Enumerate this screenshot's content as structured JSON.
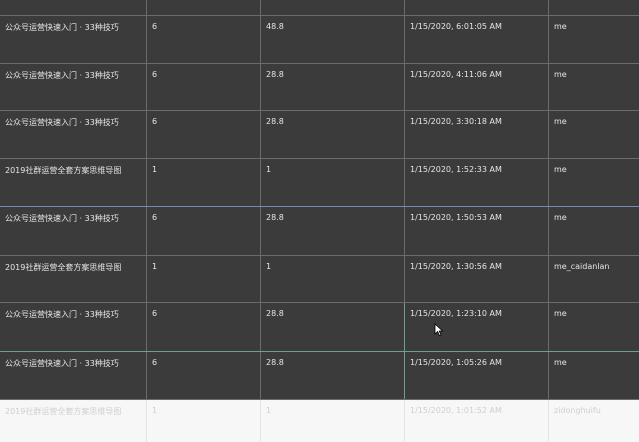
{
  "rows": [
    {
      "title": "公众号运营快速入门 · 33种技巧",
      "qty": "6",
      "amount": "48.8",
      "time": "1/15/2020, 6:01:05 AM",
      "user": "me"
    },
    {
      "title": "公众号运营快速入门 · 33种技巧",
      "qty": "6",
      "amount": "28.8",
      "time": "1/15/2020, 4:11:06 AM",
      "user": "me"
    },
    {
      "title": "公众号运营快速入门 · 33种技巧",
      "qty": "6",
      "amount": "28.8",
      "time": "1/15/2020, 3:30:18 AM",
      "user": "me"
    },
    {
      "title": "2019社群运营全套方案思维导图",
      "qty": "1",
      "amount": "1",
      "time": "1/15/2020, 1:52:33 AM",
      "user": "me"
    },
    {
      "title": "公众号运营快速入门 · 33种技巧",
      "qty": "6",
      "amount": "28.8",
      "time": "1/15/2020, 1:50:53 AM",
      "user": "me"
    },
    {
      "title": "2019社群运营全套方案思维导图",
      "qty": "1",
      "amount": "1",
      "time": "1/15/2020, 1:30:56 AM",
      "user": "me_caidanlan"
    },
    {
      "title": "公众号运营快速入门 · 33种技巧",
      "qty": "6",
      "amount": "28.8",
      "time": "1/15/2020, 1:23:10 AM",
      "user": "me"
    },
    {
      "title": "公众号运营快速入门 · 33种技巧",
      "qty": "6",
      "amount": "28.8",
      "time": "1/15/2020, 1:05:26 AM",
      "user": "me"
    },
    {
      "title": "2019社群运营全套方案思维导图",
      "qty": "1",
      "amount": "1",
      "time": "1/15/2020, 1:01:52 AM",
      "user": "zidonghuifu"
    }
  ]
}
